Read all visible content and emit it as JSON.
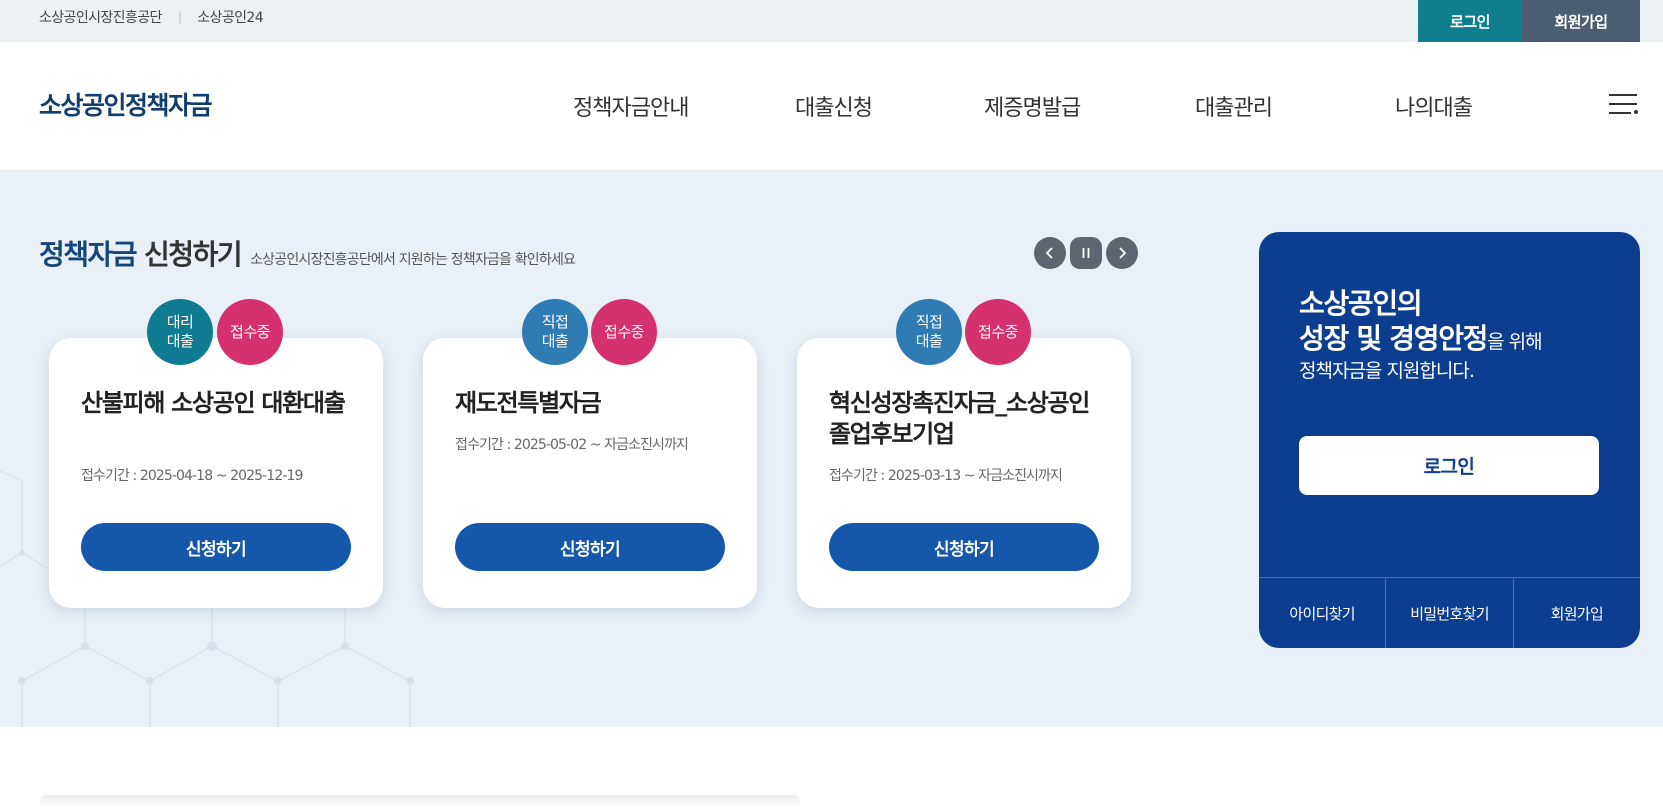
{
  "topbar": {
    "links": [
      "소상공인시장진흥공단",
      "소상공인24"
    ],
    "login_label": "로그인",
    "join_label": "회원가입"
  },
  "header": {
    "logo": "소상공인정책자금",
    "nav": [
      "정책자금안내",
      "대출신청",
      "제증명발급",
      "대출관리",
      "나의대출"
    ],
    "menu_icon": "hamburger-menu-icon"
  },
  "section": {
    "title_highlight": "정책자금",
    "title_rest": "신청하기",
    "description": "소상공인시장진흥공단에서 지원하는 정책자금을 확인하세요",
    "controls": [
      "prev-icon",
      "pause-icon",
      "next-icon"
    ]
  },
  "cards": [
    {
      "type_badge": [
        "대리",
        "대출"
      ],
      "status_badge": "접수중",
      "title": "산불피해 소상공인 대환대출",
      "period": "접수기간 : 2025-04-18 ~ 2025-12-19",
      "button": "신청하기"
    },
    {
      "type_badge": [
        "직접",
        "대출"
      ],
      "status_badge": "접수중",
      "title": "재도전특별자금",
      "period": "접수기간 : 2025-05-02 ~ 자금소진시까지",
      "button": "신청하기"
    },
    {
      "type_badge": [
        "직접",
        "대출"
      ],
      "status_badge": "접수중",
      "title": "혁신성장촉진자금_소상공인 졸업후보기업",
      "period": "접수기간 : 2025-03-13 ~ 자금소진시까지",
      "button": "신청하기"
    }
  ],
  "login_panel": {
    "line1": "소상공인의",
    "line2_bold": "성장 및 경영안정",
    "line2_rest": "을 위해",
    "line3": "정책자금을 지원합니다.",
    "login_button": "로그인",
    "links": [
      "아이디찾기",
      "비밀번호찾기",
      "회원가입"
    ]
  },
  "colors": {
    "brand_navy": "#0d3d8e",
    "apply_blue": "#1558ab",
    "teal": "#0f7f8d",
    "status_pink": "#d6316f",
    "hero_bg": "#e9f0f7"
  }
}
